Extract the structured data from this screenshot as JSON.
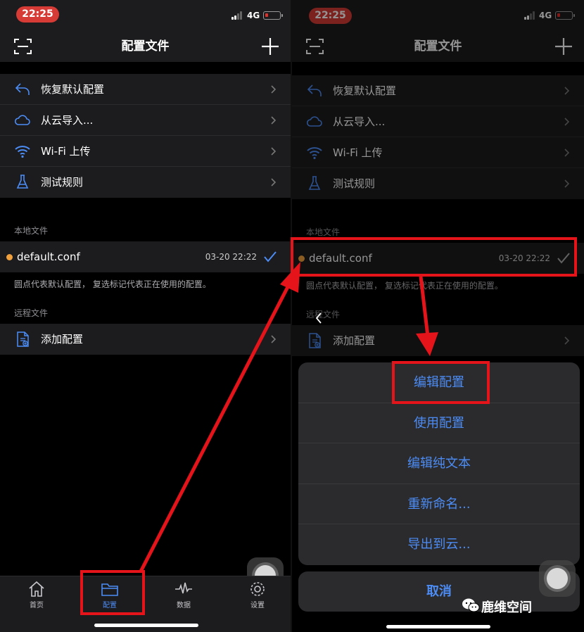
{
  "status": {
    "time": "22:25",
    "network": "4G"
  },
  "nav": {
    "title": "配置文件"
  },
  "menu": [
    {
      "label": "恢复默认配置",
      "icon": "undo-icon"
    },
    {
      "label": "从云导入...",
      "icon": "cloud-icon"
    },
    {
      "label": "Wi-Fi 上传",
      "icon": "wifi-icon"
    },
    {
      "label": "测试规则",
      "icon": "flask-icon"
    }
  ],
  "local": {
    "section_label": "本地文件",
    "file_name": "default.conf",
    "file_date": "03-20 22:22",
    "hint": "圆点代表默认配置， 复选标记代表正在使用的配置。"
  },
  "remote": {
    "section_label": "远程文件",
    "add_label": "添加配置"
  },
  "tabs": [
    {
      "label": "首页",
      "icon": "home-icon"
    },
    {
      "label": "配置",
      "icon": "folder-icon"
    },
    {
      "label": "数据",
      "icon": "activity-icon"
    },
    {
      "label": "设置",
      "icon": "gear-icon"
    }
  ],
  "action_sheet": {
    "actions": [
      "编辑配置",
      "使用配置",
      "编辑纯文本",
      "重新命名...",
      "导出到云..."
    ],
    "cancel": "取消"
  },
  "watermark": "鹿维空间",
  "colors": {
    "accent": "#4c8cf5",
    "highlight": "#e5141a",
    "default_dot": "#f0a03c",
    "time_pill": "#d63b35"
  }
}
